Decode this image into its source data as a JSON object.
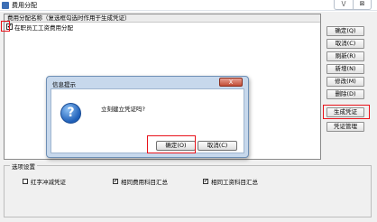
{
  "window": {
    "title": "费用分配",
    "minimize_glyph": "\\/",
    "close_glyph": "⊠"
  },
  "list": {
    "header": "费用分配名称（复选框勾选时作用于生成凭证）",
    "rows": [
      {
        "label": "在职员工工资费用分配",
        "checked": true
      }
    ]
  },
  "side_buttons": [
    "确定(Q)",
    "取消(C)",
    "刷新(R)",
    "新增(N)",
    "修改(M)",
    "删除(D)",
    "生成凭证",
    "凭证管理"
  ],
  "options": {
    "legend": "选项设置",
    "items": [
      {
        "label": "红字冲减凭证",
        "checked": false
      },
      {
        "label": "相同费用科目汇总",
        "checked": true
      },
      {
        "label": "相同工资科目汇总",
        "checked": true
      }
    ]
  },
  "dialog": {
    "title": "信息提示",
    "close_glyph": "X",
    "icon": "question-icon",
    "icon_glyph": "?",
    "message": "立刻建立凭证吗?",
    "ok_label": "确定(O)",
    "cancel_label": "取消(C)"
  },
  "colors": {
    "highlight": "#e8131b",
    "dialog_frame": "#c7d8ec"
  }
}
